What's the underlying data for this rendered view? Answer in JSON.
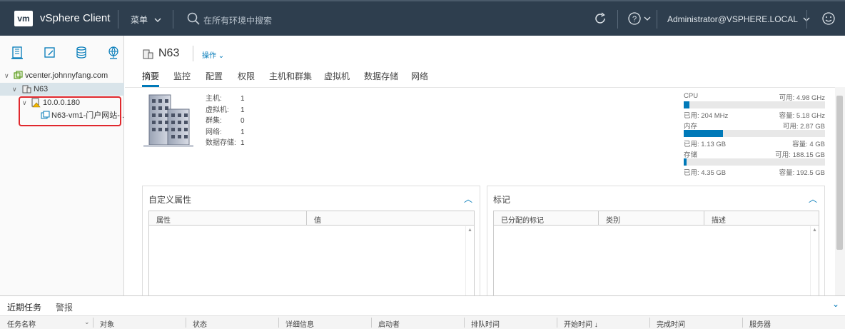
{
  "header": {
    "logo": "vm",
    "app_name": "vSphere Client",
    "menu_label": "菜单",
    "search_placeholder": "在所有环境中搜索",
    "user": "Administrator@VSPHERE.LOCAL"
  },
  "sidebar": {
    "tree": [
      {
        "label": "vcenter.johnnyfang.com",
        "icon": "vcenter-icon"
      },
      {
        "label": "N63",
        "icon": "datacenter-icon"
      },
      {
        "label": "10.0.0.180",
        "icon": "host-warning-icon"
      },
      {
        "label": "N63-vm1-门户网站-...",
        "icon": "vm-icon"
      }
    ]
  },
  "main": {
    "title": "N63",
    "actions_label": "操作",
    "tabs": [
      "摘要",
      "监控",
      "配置",
      "权限",
      "主机和群集",
      "虚拟机",
      "数据存储",
      "网络"
    ],
    "properties": [
      {
        "key": "主机:",
        "value": "1"
      },
      {
        "key": "虚拟机:",
        "value": "1"
      },
      {
        "key": "群集:",
        "value": "0"
      },
      {
        "key": "网络:",
        "value": "1"
      },
      {
        "key": "数据存储:",
        "value": "1"
      }
    ],
    "resources": [
      {
        "name": "CPU",
        "free": "可用: 4.98 GHz",
        "used": "已用: 204 MHz",
        "capacity": "容量: 5.18 GHz",
        "used_fraction": 0.04
      },
      {
        "name": "内存",
        "free": "可用: 2.87 GB",
        "used": "已用: 1.13 GB",
        "capacity": "容量: 4 GB",
        "used_fraction": 0.28
      },
      {
        "name": "存储",
        "free": "可用: 188.15 GB",
        "used": "已用: 4.35 GB",
        "capacity": "容量: 192.5 GB",
        "used_fraction": 0.02
      }
    ],
    "custom_attrs": {
      "title": "自定义属性",
      "columns": [
        "属性",
        "值"
      ]
    },
    "tags": {
      "title": "标记",
      "columns": [
        "已分配的标记",
        "类别",
        "描述"
      ]
    }
  },
  "bottom": {
    "tabs": [
      "近期任务",
      "警报"
    ],
    "columns": [
      "任务名称",
      "对象",
      "状态",
      "详细信息",
      "启动者",
      "排队时间",
      "开始时间 ↓",
      "完成时间",
      "服务器"
    ]
  },
  "colors": {
    "header": "#2e3e4e",
    "accent": "#0079b8",
    "highlight": "#e0282d"
  }
}
